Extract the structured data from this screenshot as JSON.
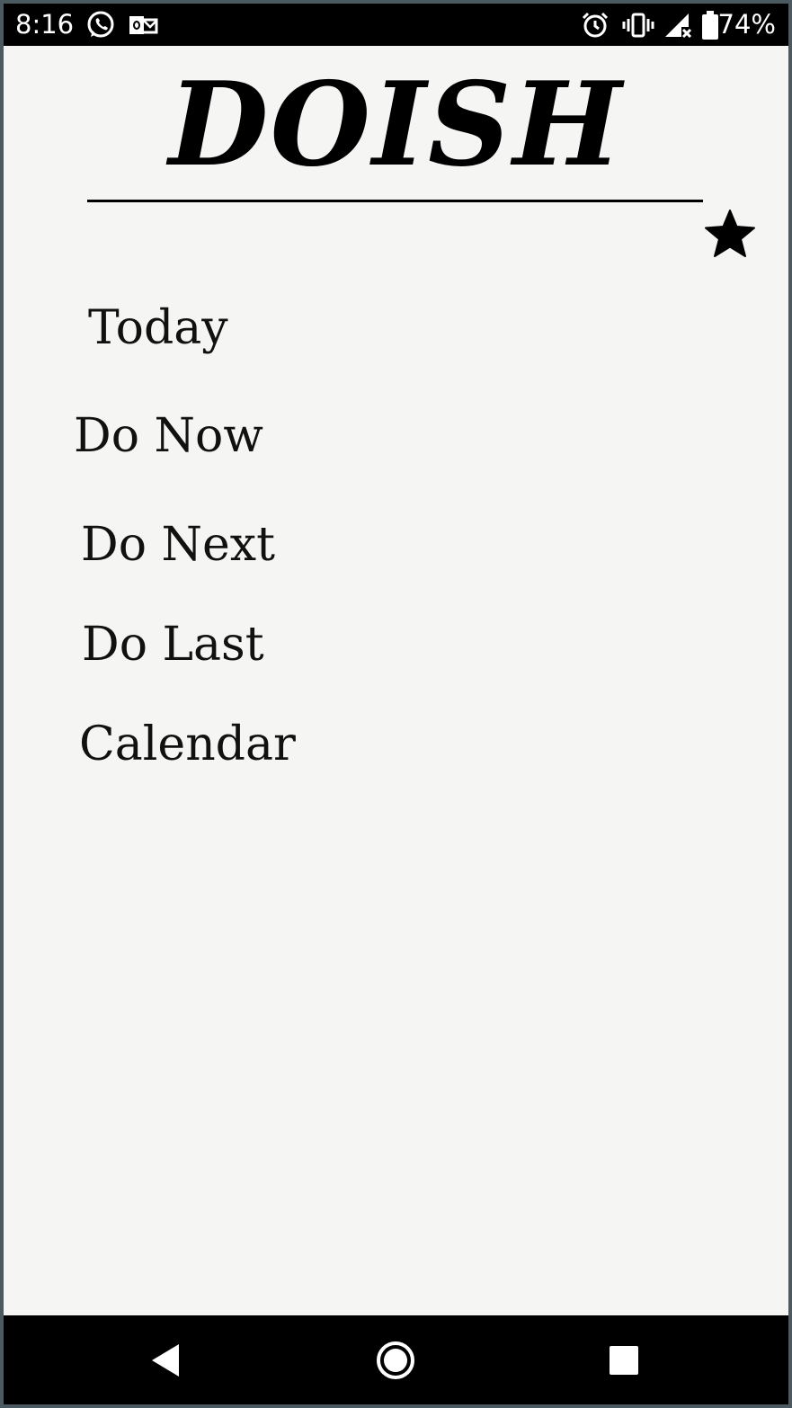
{
  "status_bar": {
    "time": "8:16",
    "battery": "74%",
    "left_icons": [
      "whatsapp-icon",
      "outlook-icon"
    ],
    "right_icons": [
      "alarm-icon",
      "vibrate-icon",
      "signal-icon",
      "battery-icon"
    ]
  },
  "header": {
    "title": "DOISH",
    "star_icon": "star-icon"
  },
  "menu": {
    "items": [
      {
        "label": "Today"
      },
      {
        "label": "Do Now"
      },
      {
        "label": "Do Next"
      },
      {
        "label": "Do Last"
      },
      {
        "label": "Calendar"
      }
    ]
  },
  "nav_bar": {
    "icons": [
      "back-icon",
      "home-icon",
      "recents-icon"
    ]
  },
  "colors": {
    "background": "#f5f5f4",
    "text": "#111111",
    "bars": "#000000"
  }
}
